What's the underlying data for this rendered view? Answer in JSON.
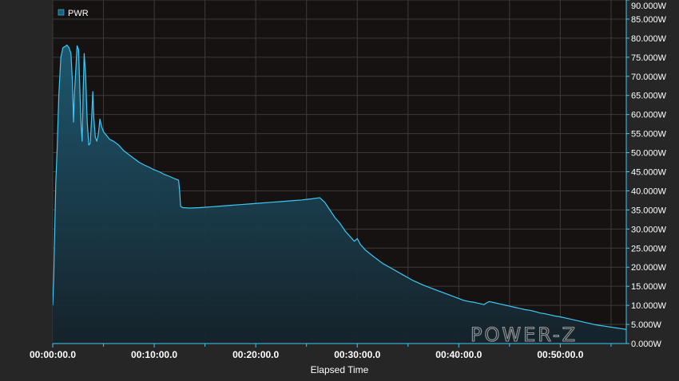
{
  "chart_data": {
    "type": "area",
    "title": "",
    "xlabel": "Elapsed Time",
    "ylabel": "",
    "x_unit": "minutes",
    "xlim": [
      0,
      56.5
    ],
    "ylim": [
      0,
      90
    ],
    "x_ticks": [
      {
        "value": 0,
        "label": "00:00:00.0"
      },
      {
        "value": 10,
        "label": "00:10:00.0"
      },
      {
        "value": 20,
        "label": "00:20:00.0"
      },
      {
        "value": 30,
        "label": "00:30:00.0"
      },
      {
        "value": 40,
        "label": "00:40:00.0"
      },
      {
        "value": 50,
        "label": "00:50:00.0"
      }
    ],
    "y_ticks": [
      {
        "value": 0,
        "label": "0.000W"
      },
      {
        "value": 5,
        "label": "5.000W"
      },
      {
        "value": 10,
        "label": "10.000W"
      },
      {
        "value": 15,
        "label": "15.000W"
      },
      {
        "value": 20,
        "label": "20.000W"
      },
      {
        "value": 25,
        "label": "25.000W"
      },
      {
        "value": 30,
        "label": "30.000W"
      },
      {
        "value": 35,
        "label": "35.000W"
      },
      {
        "value": 40,
        "label": "40.000W"
      },
      {
        "value": 45,
        "label": "45.000W"
      },
      {
        "value": 50,
        "label": "50.000W"
      },
      {
        "value": 55,
        "label": "55.000W"
      },
      {
        "value": 60,
        "label": "60.000W"
      },
      {
        "value": 65,
        "label": "65.000W"
      },
      {
        "value": 70,
        "label": "70.000W"
      },
      {
        "value": 75,
        "label": "75.000W"
      },
      {
        "value": 80,
        "label": "80.000W"
      },
      {
        "value": 85,
        "label": "85.000W"
      },
      {
        "value": 90,
        "label": "90.000W"
      }
    ],
    "grid": true,
    "legend_position": "top-left",
    "series": [
      {
        "name": "PWR",
        "color": "#3ec8f5",
        "points": [
          [
            0.0,
            10.0
          ],
          [
            0.1,
            17.0
          ],
          [
            0.2,
            30.0
          ],
          [
            0.3,
            42.0
          ],
          [
            0.45,
            52.0
          ],
          [
            0.6,
            65.0
          ],
          [
            0.8,
            75.0
          ],
          [
            1.0,
            77.5
          ],
          [
            1.2,
            77.8
          ],
          [
            1.4,
            78.2
          ],
          [
            1.6,
            77.5
          ],
          [
            1.8,
            76.0
          ],
          [
            1.95,
            68.0
          ],
          [
            2.05,
            58.0
          ],
          [
            2.15,
            66.0
          ],
          [
            2.3,
            73.0
          ],
          [
            2.4,
            78.0
          ],
          [
            2.55,
            77.0
          ],
          [
            2.7,
            64.0
          ],
          [
            2.8,
            57.0
          ],
          [
            2.9,
            53.0
          ],
          [
            3.0,
            66.0
          ],
          [
            3.1,
            76.0
          ],
          [
            3.25,
            70.0
          ],
          [
            3.4,
            58.0
          ],
          [
            3.55,
            52.0
          ],
          [
            3.7,
            52.5
          ],
          [
            3.85,
            60.0
          ],
          [
            3.95,
            66.0
          ],
          [
            4.05,
            59.0
          ],
          [
            4.2,
            54.0
          ],
          [
            4.35,
            53.0
          ],
          [
            4.5,
            55.0
          ],
          [
            4.65,
            58.8
          ],
          [
            4.8,
            57.0
          ],
          [
            5.0,
            55.5
          ],
          [
            5.3,
            54.5
          ],
          [
            5.6,
            53.5
          ],
          [
            6.0,
            53.0
          ],
          [
            6.5,
            52.0
          ],
          [
            7.0,
            50.5
          ],
          [
            7.5,
            49.5
          ],
          [
            8.0,
            48.5
          ],
          [
            8.5,
            47.5
          ],
          [
            9.0,
            46.8
          ],
          [
            9.5,
            46.2
          ],
          [
            10.0,
            45.5
          ],
          [
            10.5,
            45.0
          ],
          [
            11.0,
            44.3
          ],
          [
            11.5,
            43.8
          ],
          [
            12.0,
            43.2
          ],
          [
            12.4,
            42.8
          ],
          [
            12.5,
            40.0
          ],
          [
            12.6,
            36.0
          ],
          [
            12.8,
            35.6
          ],
          [
            13.5,
            35.5
          ],
          [
            14.5,
            35.6
          ],
          [
            15.5,
            35.8
          ],
          [
            16.5,
            36.0
          ],
          [
            17.5,
            36.2
          ],
          [
            18.5,
            36.4
          ],
          [
            19.5,
            36.6
          ],
          [
            20.5,
            36.8
          ],
          [
            21.5,
            37.0
          ],
          [
            22.5,
            37.2
          ],
          [
            23.5,
            37.4
          ],
          [
            24.5,
            37.6
          ],
          [
            25.5,
            37.9
          ],
          [
            26.3,
            38.2
          ],
          [
            26.8,
            37.0
          ],
          [
            27.3,
            35.0
          ],
          [
            27.8,
            33.0
          ],
          [
            28.3,
            31.5
          ],
          [
            28.8,
            29.5
          ],
          [
            29.3,
            28.0
          ],
          [
            29.7,
            26.8
          ],
          [
            30.0,
            27.5
          ],
          [
            30.3,
            26.0
          ],
          [
            30.8,
            24.5
          ],
          [
            31.5,
            23.0
          ],
          [
            32.5,
            21.0
          ],
          [
            33.5,
            19.5
          ],
          [
            34.5,
            18.0
          ],
          [
            35.5,
            16.5
          ],
          [
            36.5,
            15.3
          ],
          [
            37.5,
            14.3
          ],
          [
            38.5,
            13.3
          ],
          [
            39.5,
            12.3
          ],
          [
            40.5,
            11.3
          ],
          [
            41.0,
            11.0
          ],
          [
            41.5,
            10.8
          ],
          [
            42.0,
            10.5
          ],
          [
            42.5,
            10.2
          ],
          [
            42.7,
            10.6
          ],
          [
            43.0,
            11.0
          ],
          [
            43.5,
            10.7
          ],
          [
            44.0,
            10.4
          ],
          [
            44.5,
            10.1
          ],
          [
            45.0,
            9.8
          ],
          [
            45.5,
            9.5
          ],
          [
            46.0,
            9.2
          ],
          [
            46.5,
            8.9
          ],
          [
            47.0,
            8.7
          ],
          [
            47.5,
            8.4
          ],
          [
            48.0,
            8.0
          ],
          [
            48.5,
            7.8
          ],
          [
            49.0,
            7.5
          ],
          [
            49.5,
            7.2
          ],
          [
            50.0,
            7.0
          ],
          [
            50.5,
            6.7
          ],
          [
            51.0,
            6.4
          ],
          [
            51.5,
            6.1
          ],
          [
            52.0,
            5.8
          ],
          [
            52.5,
            5.5
          ],
          [
            53.0,
            5.2
          ],
          [
            53.5,
            4.9
          ],
          [
            54.0,
            4.7
          ],
          [
            54.5,
            4.5
          ],
          [
            55.0,
            4.3
          ],
          [
            55.5,
            4.1
          ],
          [
            56.0,
            3.9
          ],
          [
            56.5,
            3.7
          ]
        ]
      }
    ]
  },
  "legend": {
    "label": "PWR",
    "color": "#1b5e79"
  },
  "watermark": {
    "text": "POWER-Z"
  },
  "colors": {
    "plot_background": "#161212",
    "grid": "#3c3a3a",
    "line": "#3ec8f5",
    "fill_top": "#1e5a72",
    "fill_bottom": "#15232b"
  }
}
